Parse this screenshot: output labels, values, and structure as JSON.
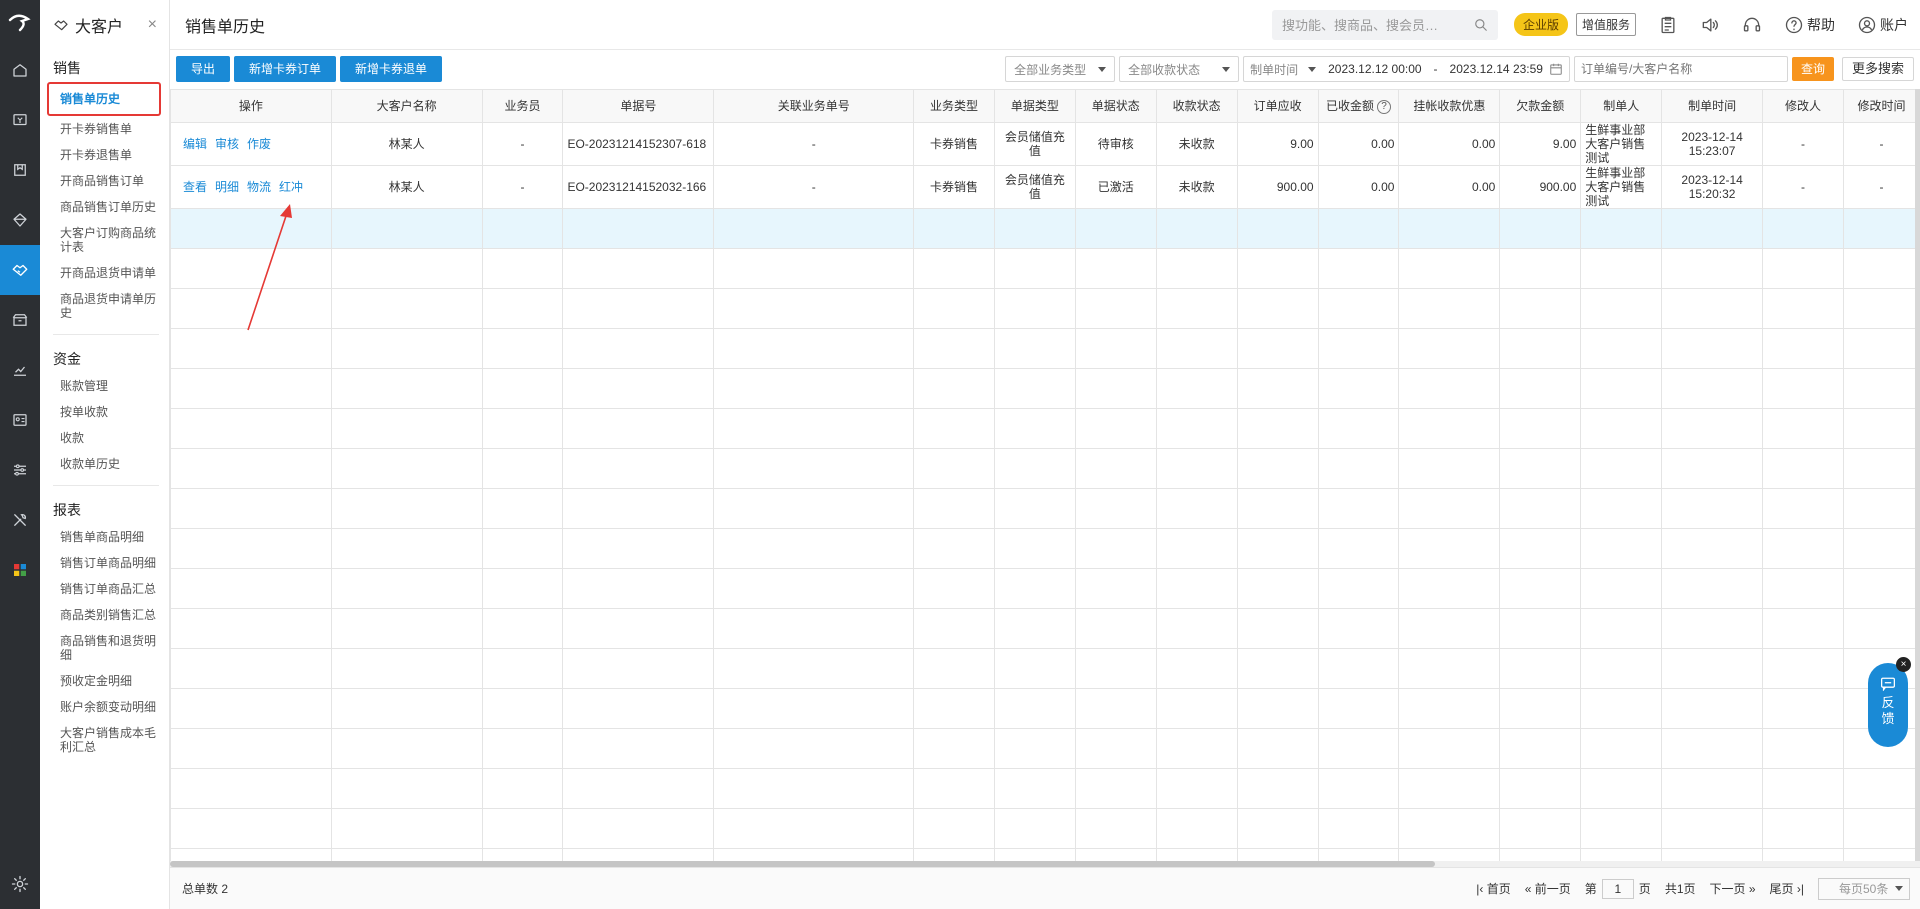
{
  "app": {
    "brand_color": "#1a8ad6",
    "danger_color": "#e53935",
    "accent_orange": "#f7941d"
  },
  "rail": {
    "icons": [
      "home-icon",
      "cashier-icon",
      "book-icon",
      "diamond-icon",
      "handshake-icon",
      "store-icon",
      "chart-icon",
      "id-card-icon",
      "sliders-icon",
      "tools-icon",
      "apps-icon"
    ],
    "active_index": 4,
    "bottom_icon": "settings-icon"
  },
  "sidebar": {
    "title": "大客户",
    "close": "×",
    "groups": [
      {
        "title": "销售",
        "items": [
          "销售单历史",
          "开卡券销售单",
          "开卡券退售单",
          "开商品销售订单",
          "商品销售订单历史",
          "大客户订购商品统计表",
          "开商品退货申请单",
          "商品退货申请单历史"
        ]
      },
      {
        "title": "资金",
        "items": [
          "账款管理",
          "按单收款",
          "收款",
          "收款单历史"
        ]
      },
      {
        "title": "报表",
        "items": [
          "销售单商品明细",
          "销售订单商品明细",
          "销售订单商品汇总",
          "商品类别销售汇总",
          "商品销售和退货明细",
          "预收定金明细",
          "账户余额变动明细",
          "大客户销售成本毛利汇总"
        ]
      }
    ]
  },
  "topbar": {
    "page_title": "销售单历史",
    "search_placeholder": "搜功能、搜商品、搜会员…",
    "badge_enterprise": "企业版",
    "badge_value_added": "增值服务",
    "help_label": "帮助",
    "account_label": "账户"
  },
  "toolbar": {
    "export": "导出",
    "new_card_order": "新增卡券订单",
    "new_card_return": "新增卡券退单",
    "biz_type": "全部业务类型",
    "pay_status": "全部收款状态",
    "time_type": "制单时间",
    "date_from": "2023.12.12 00:00",
    "date_sep": "-",
    "date_to": "2023.12.14 23:59",
    "keyword_placeholder": "订单编号/大客户名称",
    "query": "查询",
    "more_search": "更多搜索"
  },
  "table": {
    "columns": [
      "操作",
      "大客户名称",
      "业务员",
      "单据号",
      "关联业务单号",
      "业务类型",
      "单据类型",
      "单据状态",
      "收款状态",
      "订单应收",
      "已收金额",
      "挂帐收款优惠",
      "欠款金额",
      "制单人",
      "制单时间",
      "修改人",
      "修改时间"
    ],
    "help_mark": "?",
    "rows": [
      {
        "ops": [
          "编辑",
          "审核",
          "作废"
        ],
        "customer": "林某人",
        "salesman": "-",
        "doc_no": "EO-20231214152307-618",
        "related_no": "-",
        "biz_type": "卡券销售",
        "doc_type": "会员储值充值",
        "doc_status": "待审核",
        "pay_status": "未收款",
        "receivable": "9.00",
        "received": "0.00",
        "discount": "0.00",
        "owed": "9.00",
        "creator": "生鲜事业部大客户销售测试",
        "created_time": "2023-12-14 15:23:07",
        "modifier": "-",
        "modified_time": "-"
      },
      {
        "ops": [
          "查看",
          "明细",
          "物流",
          "红冲"
        ],
        "customer": "林某人",
        "salesman": "-",
        "doc_no": "EO-20231214152032-166",
        "related_no": "-",
        "biz_type": "卡券销售",
        "doc_type": "会员储值充值",
        "doc_status": "已激活",
        "pay_status": "未收款",
        "receivable": "900.00",
        "received": "0.00",
        "discount": "0.00",
        "owed": "900.00",
        "creator": "生鲜事业部大客户销售测试",
        "created_time": "2023-12-14 15:20:32",
        "modifier": "-",
        "modified_time": "-"
      }
    ]
  },
  "footer": {
    "total": "总单数 2",
    "first": "首页",
    "prev": "前一页",
    "page_prefix": "第",
    "page_value": "1",
    "page_suffix": "页",
    "page_total": "共1页",
    "next": "下一页",
    "last": "尾页",
    "page_size": "每页50条"
  },
  "feedback": {
    "label1": "反",
    "label2": "馈",
    "close": "×"
  }
}
